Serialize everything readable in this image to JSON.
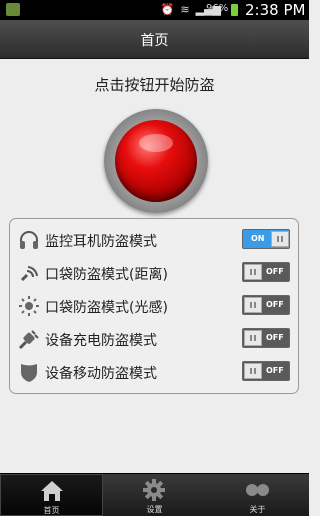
{
  "status_bar": {
    "battery_percent": "96%",
    "time": "2:38 PM"
  },
  "header": {
    "title": "首页"
  },
  "main": {
    "prompt": "点击按钮开始防盗"
  },
  "modes": [
    {
      "label": "监控耳机防盗模式",
      "icon": "headphones-icon",
      "state": "ON"
    },
    {
      "label": "口袋防盗模式(距离)",
      "icon": "proximity-icon",
      "state": "OFF"
    },
    {
      "label": "口袋防盗模式(光感)",
      "icon": "light-sensor-icon",
      "state": "OFF"
    },
    {
      "label": "设备充电防盗模式",
      "icon": "charger-plug-icon",
      "state": "OFF"
    },
    {
      "label": "设备移动防盗模式",
      "icon": "shield-icon",
      "state": "OFF"
    }
  ],
  "bottom_nav": [
    {
      "label": "首页",
      "icon": "home-icon",
      "active": true
    },
    {
      "label": "设置",
      "icon": "gear-icon",
      "active": false
    },
    {
      "label": "关于",
      "icon": "about-icon",
      "active": false
    }
  ],
  "colors": {
    "toggle_on": "#3a9be6",
    "toggle_off": "#5a5a5a",
    "alarm_button": "#e80d0d"
  }
}
